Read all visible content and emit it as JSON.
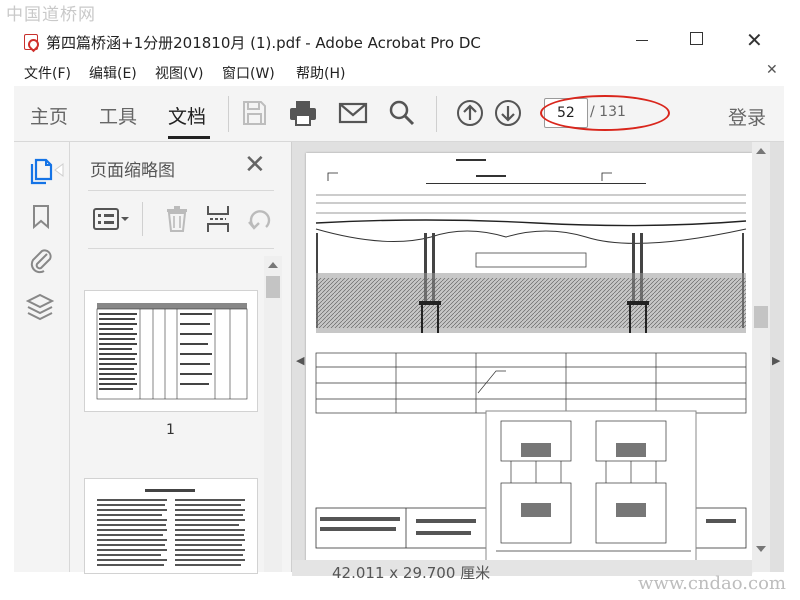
{
  "watermark": {
    "top": "中国道桥网",
    "bottom": "www.cndao.com"
  },
  "window": {
    "title": "第四篇桥涵+1分册201810月 (1).pdf - Adobe Acrobat Pro DC"
  },
  "menu": [
    "文件(F)",
    "编辑(E)",
    "视图(V)",
    "窗口(W)",
    "帮助(H)"
  ],
  "toolbar": {
    "tabs": [
      {
        "label": "主页",
        "active": false
      },
      {
        "label": "工具",
        "active": false
      },
      {
        "label": "文档",
        "active": true
      }
    ],
    "current_page": "52",
    "total_pages": "/ 131",
    "login_label": "登录"
  },
  "thumbnails": {
    "title": "页面缩略图",
    "pages": [
      "1"
    ]
  },
  "document": {
    "dimensions": "42.011 x 29.700 厘米"
  },
  "icons": {
    "rail": [
      "pages-icon",
      "bookmark-icon",
      "attachment-icon",
      "layers-icon"
    ],
    "tools": [
      "save-icon",
      "print-icon",
      "email-icon",
      "search-icon",
      "page-up-icon",
      "page-down-icon"
    ]
  },
  "colors": {
    "highlight_oval": "#d9261c",
    "accent_blue": "#1473e6"
  }
}
